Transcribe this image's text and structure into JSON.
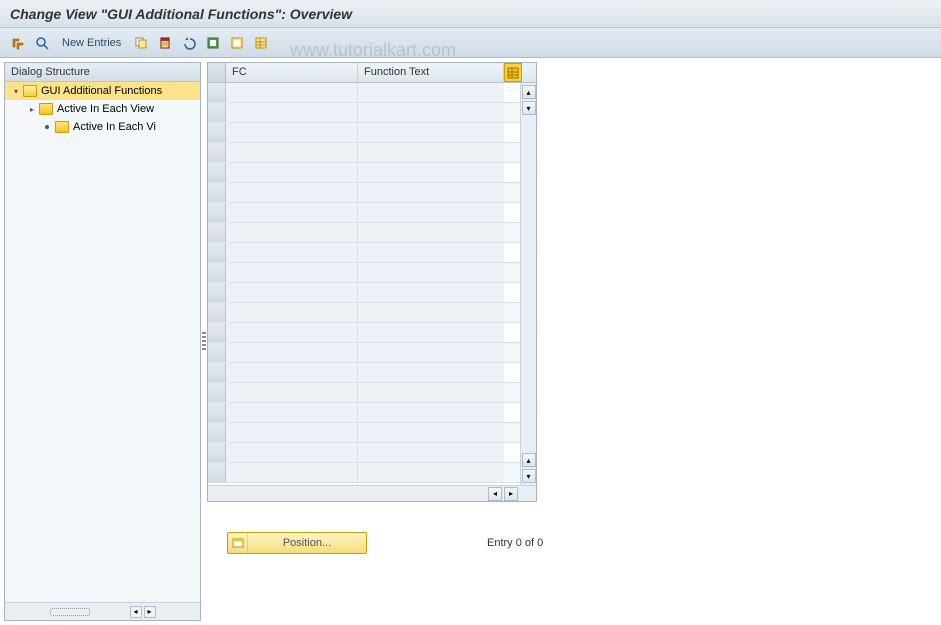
{
  "title": "Change View \"GUI Additional Functions\": Overview",
  "watermark": "www.tutorialkart.com",
  "toolbar": {
    "new_entries": "New Entries"
  },
  "tree": {
    "header": "Dialog Structure",
    "nodes": [
      {
        "label": "GUI Additional Functions",
        "level": 1,
        "selected": true,
        "open": true,
        "expandable": true
      },
      {
        "label": "Active In Each View",
        "level": 2,
        "selected": false,
        "open": false,
        "expandable": true
      },
      {
        "label": "Active In Each Vi",
        "level": 3,
        "selected": false,
        "open": false,
        "expandable": false
      }
    ]
  },
  "table": {
    "columns": {
      "fc": "FC",
      "ft": "Function Text"
    },
    "row_count": 20
  },
  "footer": {
    "position_label": "Position...",
    "entry_text": "Entry 0 of 0"
  }
}
